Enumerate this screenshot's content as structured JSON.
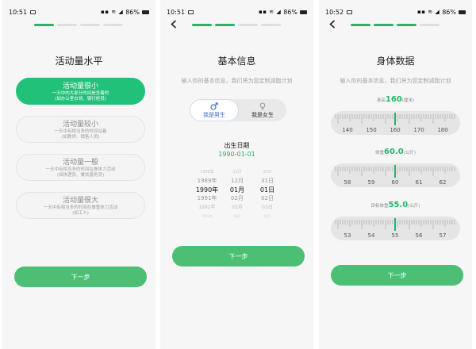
{
  "status_bars": [
    {
      "time": "10:51",
      "battery": "86%"
    },
    {
      "time": "10:51",
      "battery": "86%"
    },
    {
      "time": "10:52",
      "battery": "86%"
    }
  ],
  "screen1": {
    "title": "活动量水平",
    "options": [
      {
        "label": "活动量很小",
        "desc1": "一天中的大部分时间是坐着的",
        "desc2": "(如办公室白领、银行柜员)",
        "selected": true
      },
      {
        "label": "活动量较小",
        "desc1": "一天中有相当多的时间站着",
        "desc2": "(如教师、销售人员)",
        "selected": false
      },
      {
        "label": "活动量一般",
        "desc1": "一天中有相当多的时间在做体力活动",
        "desc2": "(如快递员、餐饮服务员)",
        "selected": false
      },
      {
        "label": "活动量很大",
        "desc1": "一天中有相当多的时间在做重体力活动",
        "desc2": "(如工人)",
        "selected": false
      }
    ],
    "next_label": "下一步",
    "progress": {
      "steps": 4,
      "current": 1
    }
  },
  "screen2": {
    "title": "基本信息",
    "subtitle": "输入你的基本信息，我们将为您定制减脂计划",
    "gender": {
      "male": "我是男生",
      "female": "我是女生",
      "selected": "male"
    },
    "dob_label": "出生日期",
    "dob_value": "1990-01-01",
    "picker": {
      "years": [
        "1987年",
        "1988年",
        "1989年",
        "1990年",
        "1991年",
        "1992年",
        "1993年"
      ],
      "months": [
        "10月",
        "11月",
        "12月",
        "01月",
        "02月",
        "03月",
        "04月"
      ],
      "days": [
        "29日",
        "30日",
        "31日",
        "01日",
        "02日",
        "03日",
        "04日"
      ]
    },
    "next_label": "下一步",
    "progress": {
      "steps": 4,
      "current": 2
    }
  },
  "screen3": {
    "title": "身体数据",
    "subtitle": "输入你的基本信息，我们将为您定制减脂计划",
    "height": {
      "label": "身高",
      "value": "160",
      "unit": "(厘米)",
      "ticks": [
        "140",
        "150",
        "160",
        "170",
        "180"
      ]
    },
    "weight": {
      "label": "体重",
      "value": "60.0",
      "unit": "(公斤)",
      "ticks": [
        "58",
        "59",
        "60",
        "61",
        "62"
      ]
    },
    "target": {
      "label": "目标体重",
      "value": "55.0",
      "unit": "(公斤)",
      "ticks": [
        "53",
        "54",
        "55",
        "56",
        "57"
      ]
    },
    "next_label": "下一步",
    "progress": {
      "steps": 4,
      "current": 3
    }
  },
  "colors": {
    "accent": "#27b46a",
    "button": "#4cbf74",
    "selected_option": "#22c17a",
    "male_blue": "#3f6fc4"
  },
  "icons": [
    "back-arrow-icon",
    "male-icon",
    "female-icon",
    "wifi-icon",
    "battery-icon",
    "image-icon"
  ]
}
